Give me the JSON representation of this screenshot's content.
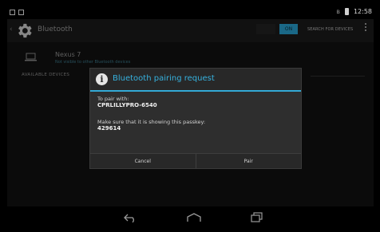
{
  "status_bar": {
    "time": "12:58",
    "bluetooth_icon": "bluetooth-icon",
    "battery_icon": "battery-icon",
    "notification_icons": [
      "notification-icon",
      "notification-icon"
    ]
  },
  "action_bar": {
    "title": "Bluetooth",
    "toggle_label": "ON",
    "search_label": "SEARCH FOR DEVICES",
    "menu_icon": "overflow-menu-icon",
    "app_icon": "settings-gear-icon"
  },
  "paired_device": {
    "name": "Nexus 7",
    "status": "Not visible to other Bluetooth devices",
    "icon": "laptop-icon"
  },
  "available_header": "AVAILABLE DEVICES",
  "dialog": {
    "icon": "info-icon",
    "title": "Bluetooth pairing request",
    "pair_label": "To pair with:",
    "device_name": "CPRLILLYPRO-6540",
    "passkey_label": "Make sure that it is showing this passkey:",
    "passkey": "429614",
    "cancel_label": "Cancel",
    "pair_label_button": "Pair"
  },
  "nav_bar": {
    "back_icon": "back-icon",
    "home_icon": "home-icon",
    "recents_icon": "recents-icon"
  },
  "colors": {
    "accent": "#33a9d6",
    "background": "#121212",
    "dialog": "#282828"
  }
}
